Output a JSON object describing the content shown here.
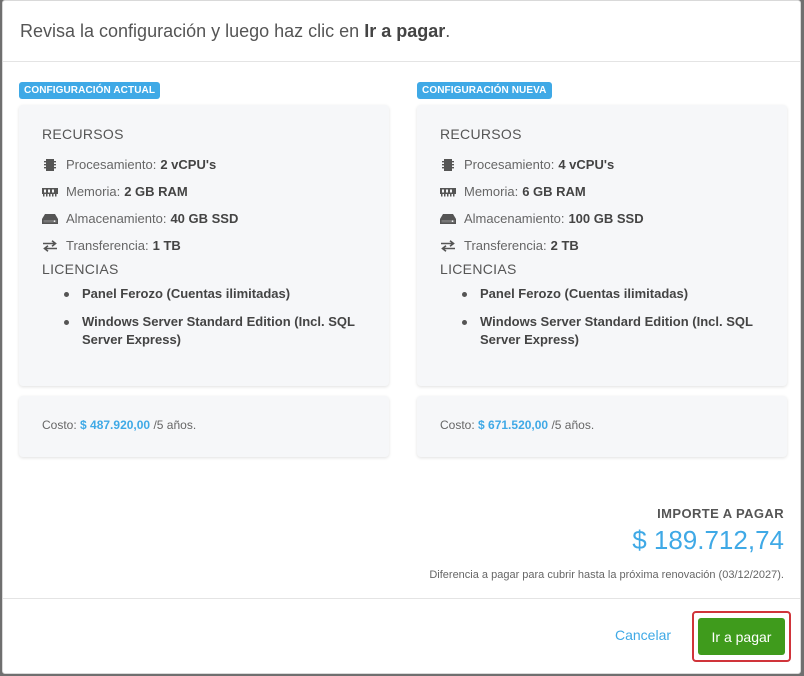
{
  "header": {
    "title_prefix": "Revisa la configuración y luego haz clic en ",
    "title_bold": "Ir a pagar",
    "title_suffix": "."
  },
  "current": {
    "badge": "CONFIGURACIÓN ACTUAL",
    "resources_title": "RECURSOS",
    "resources": [
      {
        "icon": "cpu-icon",
        "label": "Procesamiento:",
        "value": "2 vCPU's"
      },
      {
        "icon": "memory-icon",
        "label": "Memoria:",
        "value": "2 GB RAM"
      },
      {
        "icon": "storage-icon",
        "label": "Almacenamiento:",
        "value": "40 GB SSD"
      },
      {
        "icon": "transfer-icon",
        "label": "Transferencia:",
        "value": "1 TB"
      }
    ],
    "licenses_title": "LICENCIAS",
    "licenses": [
      "Panel Ferozo (Cuentas ilimitadas)",
      "Windows Server Standard Edition (Incl. SQL Server Express)"
    ],
    "cost_label": "Costo:",
    "cost_price": "$ 487.920,00",
    "cost_period": "/5 años."
  },
  "new": {
    "badge": "CONFIGURACIÓN NUEVA",
    "resources_title": "RECURSOS",
    "resources": [
      {
        "icon": "cpu-icon",
        "label": "Procesamiento:",
        "value": "4 vCPU's"
      },
      {
        "icon": "memory-icon",
        "label": "Memoria:",
        "value": "6 GB RAM"
      },
      {
        "icon": "storage-icon",
        "label": "Almacenamiento:",
        "value": "100 GB SSD"
      },
      {
        "icon": "transfer-icon",
        "label": "Transferencia:",
        "value": "2 TB"
      }
    ],
    "licenses_title": "LICENCIAS",
    "licenses": [
      "Panel Ferozo (Cuentas ilimitadas)",
      "Windows Server Standard Edition (Incl. SQL Server Express)"
    ],
    "cost_label": "Costo:",
    "cost_price": "$ 671.520,00",
    "cost_period": "/5 años."
  },
  "summary": {
    "label": "IMPORTE A PAGAR",
    "amount": "$ 189.712,74",
    "note": "Diferencia a pagar para cubrir hasta la próxima renovación (03/12/2027)."
  },
  "footer": {
    "cancel_label": "Cancelar",
    "pay_label": "Ir a pagar"
  },
  "colors": {
    "accent": "#3fa9e6",
    "pay_button": "#3f9b1c",
    "highlight_outline": "#d0343a"
  }
}
